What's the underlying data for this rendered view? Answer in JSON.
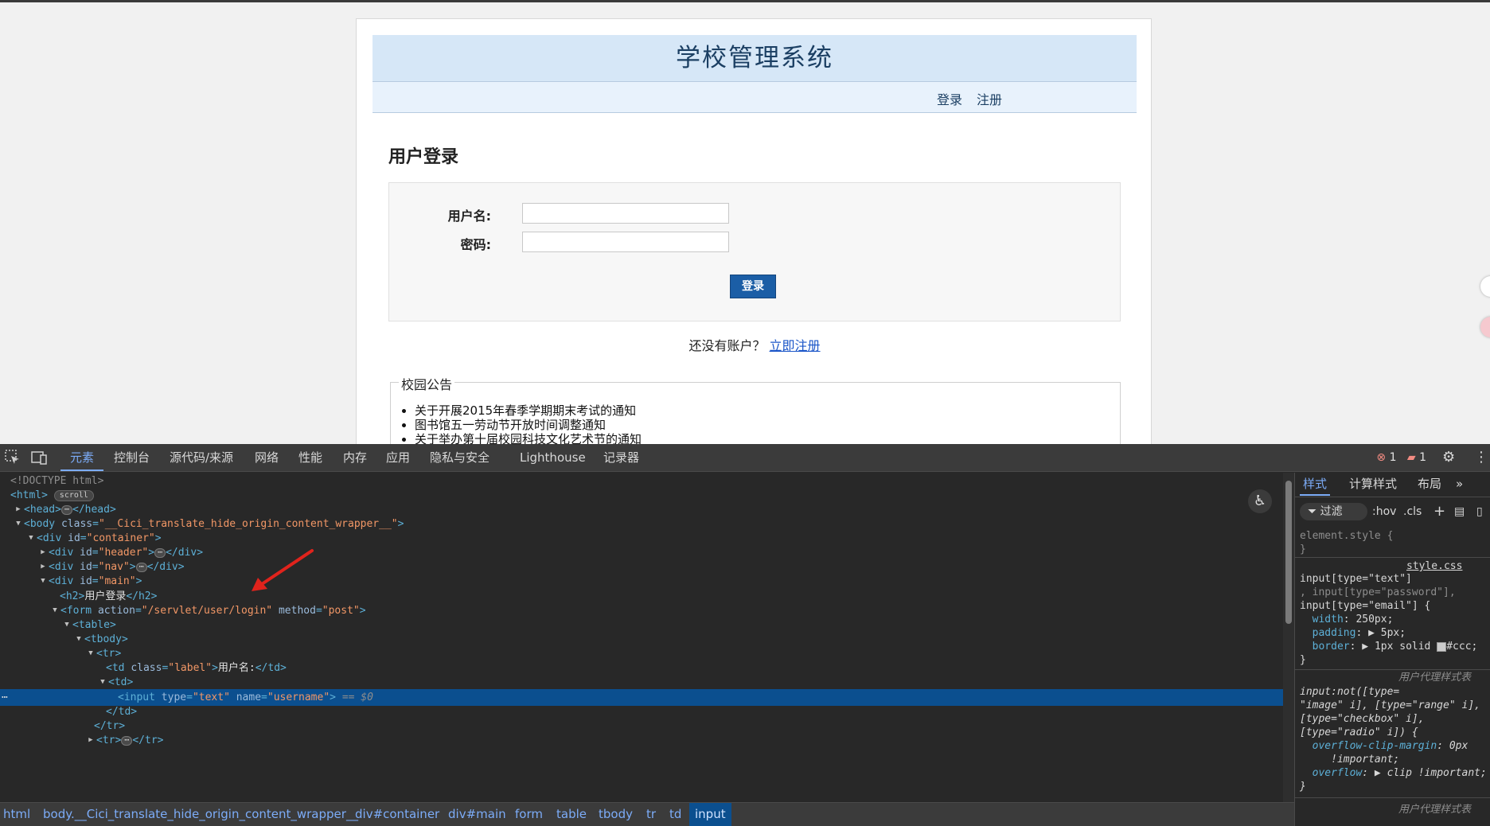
{
  "page": {
    "site_title": "学校管理系统",
    "nav": [
      "登录",
      "注册"
    ],
    "login_heading": "用户登录",
    "username_label": "用户名:",
    "password_label": "密码:",
    "login_button": "登录",
    "register_prompt": "还没有账户？",
    "register_link": "立即注册",
    "notice_legend": "校园公告",
    "notices": [
      "关于开展2015年春季学期期末考试的通知",
      "图书馆五一劳动节开放时间调整通知",
      "关于举办第十届校园科技文化艺术节的通知"
    ]
  },
  "devtools": {
    "tabs": [
      "元素",
      "控制台",
      "源代码/来源",
      "网络",
      "性能",
      "内存",
      "应用",
      "隐私与安全",
      "Lighthouse",
      "记录器"
    ],
    "errors": "1",
    "messages": "1",
    "crumbs": [
      "html",
      "body.__Cici_translate_hide_origin_content_wrapper__",
      "div#container",
      "div#main",
      "form",
      "table",
      "tbody",
      "tr",
      "td",
      "input"
    ],
    "dom": {
      "doctype": "<!DOCTYPE html>",
      "scroll_badge": "scroll",
      "body_class": "\"__Cici_translate_hide_origin_content_wrapper__\"",
      "id_container": "\"container\"",
      "id_header": "\"header\"",
      "id_nav": "\"nav\"",
      "id_main": "\"main\"",
      "h2_text": "用户登录",
      "form_action": "\"/servlet/user/login\"",
      "form_method": "\"post\"",
      "td_class": "\"label\"",
      "td_text": "用户名:",
      "input_type": "\"text\"",
      "input_name": "\"username\"",
      "selected_marker": "== $0"
    },
    "styles_tabs": [
      "样式",
      "计算样式",
      "布局"
    ],
    "filter_label": "过滤",
    "hov": ":hov",
    "cls": ".cls",
    "element_style": "element.style {",
    "stylesheet": "style.css",
    "rule_selector_1": "input[type=\"text\"]",
    "rule_selector_2": ", input[type=\"password\"],",
    "rule_selector_3": "input[type=\"email\"] {",
    "width_decl": "250px;",
    "padding_decl": "5px;",
    "border_decl": "1px solid",
    "border_color": "#ccc;",
    "ua_label": "用户代理样式表",
    "ua_selector_1": "input:not([type=",
    "ua_selector_2": "\"image\" i], [type=\"range\" i],",
    "ua_selector_3": "[type=\"checkbox\" i],",
    "ua_selector_4": "[type=\"radio\" i]) {",
    "ua_prop_1": "overflow-clip-margin",
    "ua_val_1": "0px",
    "ua_val_1b": "!important;",
    "ua_prop_2": "overflow",
    "ua_val_2": "clip !important;",
    "ua_label_2": "用户代理样式表"
  }
}
